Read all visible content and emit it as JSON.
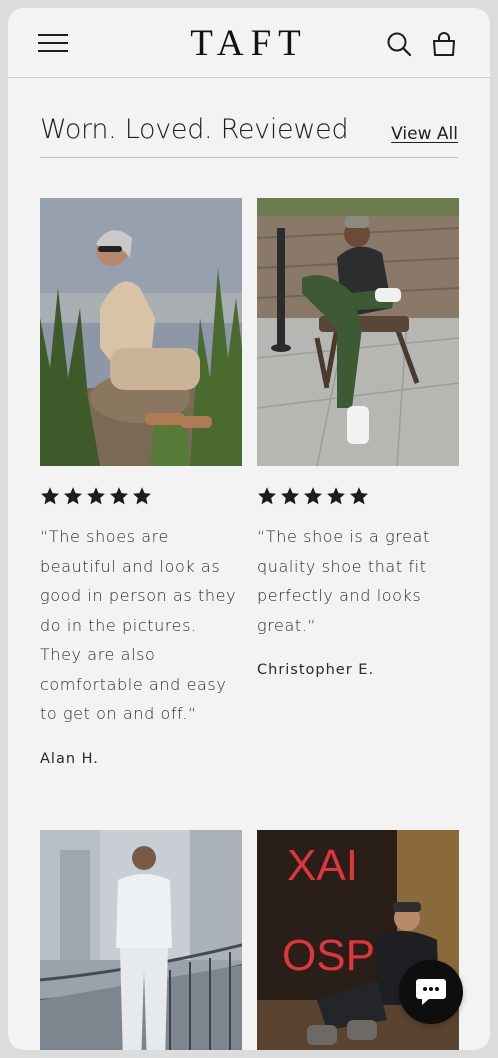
{
  "header": {
    "logo": "TAFT",
    "menu_icon": "hamburger-menu-icon",
    "search_icon": "search-icon",
    "cart_icon": "shopping-bag-icon"
  },
  "section": {
    "title": "Worn. Loved. Reviewed",
    "view_all": "View All"
  },
  "reviews": [
    {
      "rating": 5,
      "quote": "“The shoes are beautiful and look as good in person as they do in the pictures. They are also comfortable and easy to get on and off.“",
      "author": "Alan H."
    },
    {
      "rating": 5,
      "quote": "“The shoe is a great quality shoe that fit perfectly and looks great.“",
      "author": "Christopher E."
    }
  ],
  "chat": {
    "icon": "chat-bubble-icon"
  },
  "colors": {
    "background": "#f3f3f3",
    "text": "#1c1c1c",
    "star": "#1c1c1c",
    "chat": "#0e0e0e"
  }
}
